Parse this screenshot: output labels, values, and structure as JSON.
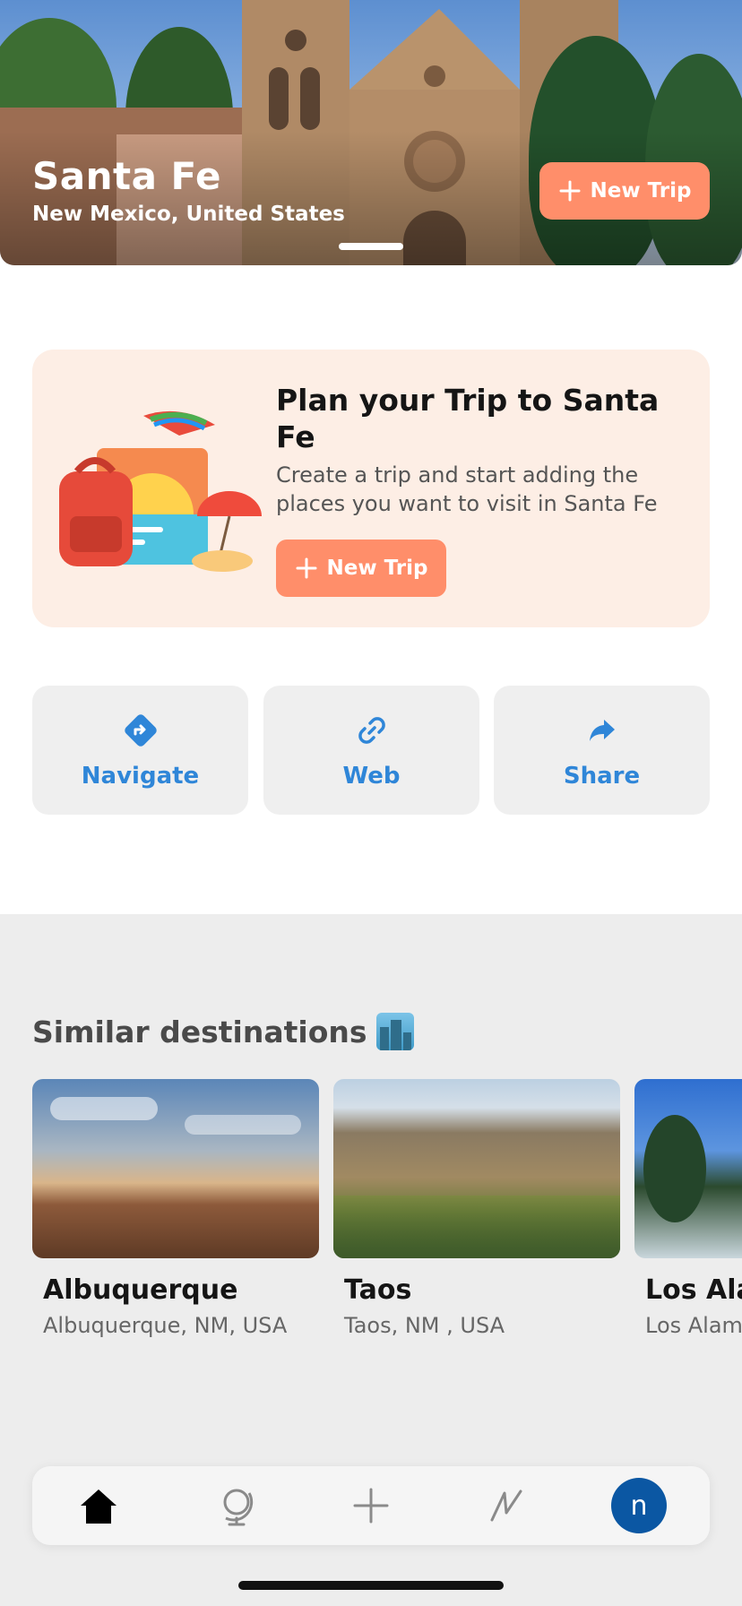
{
  "hero": {
    "title": "Santa Fe",
    "subtitle": "New Mexico, United States",
    "button_label": "New Trip"
  },
  "plan_card": {
    "title": "Plan your Trip to Santa Fe",
    "description": "Create a trip and start adding the places you want to visit in Santa Fe",
    "button_label": "New Trip"
  },
  "actions": [
    {
      "label": "Navigate",
      "icon": "navigate-icon"
    },
    {
      "label": "Web",
      "icon": "link-icon"
    },
    {
      "label": "Share",
      "icon": "share-icon"
    }
  ],
  "similar": {
    "title": "Similar destinations",
    "emoji": "city-emoji",
    "items": [
      {
        "name": "Albuquerque",
        "location": "Albuquerque, NM, USA"
      },
      {
        "name": "Taos",
        "location": "Taos, NM , USA"
      },
      {
        "name": "Los Ala",
        "location": "Los Alam"
      }
    ]
  },
  "tabbar": {
    "items": [
      "home-icon",
      "globe-icon",
      "plus-icon",
      "activity-icon",
      "avatar"
    ],
    "avatar_initial": "n"
  },
  "colors": {
    "accent": "#ff8e6a",
    "link": "#2f86d8",
    "card_bg": "#fdeee5",
    "avatar_bg": "#0b57a3"
  }
}
